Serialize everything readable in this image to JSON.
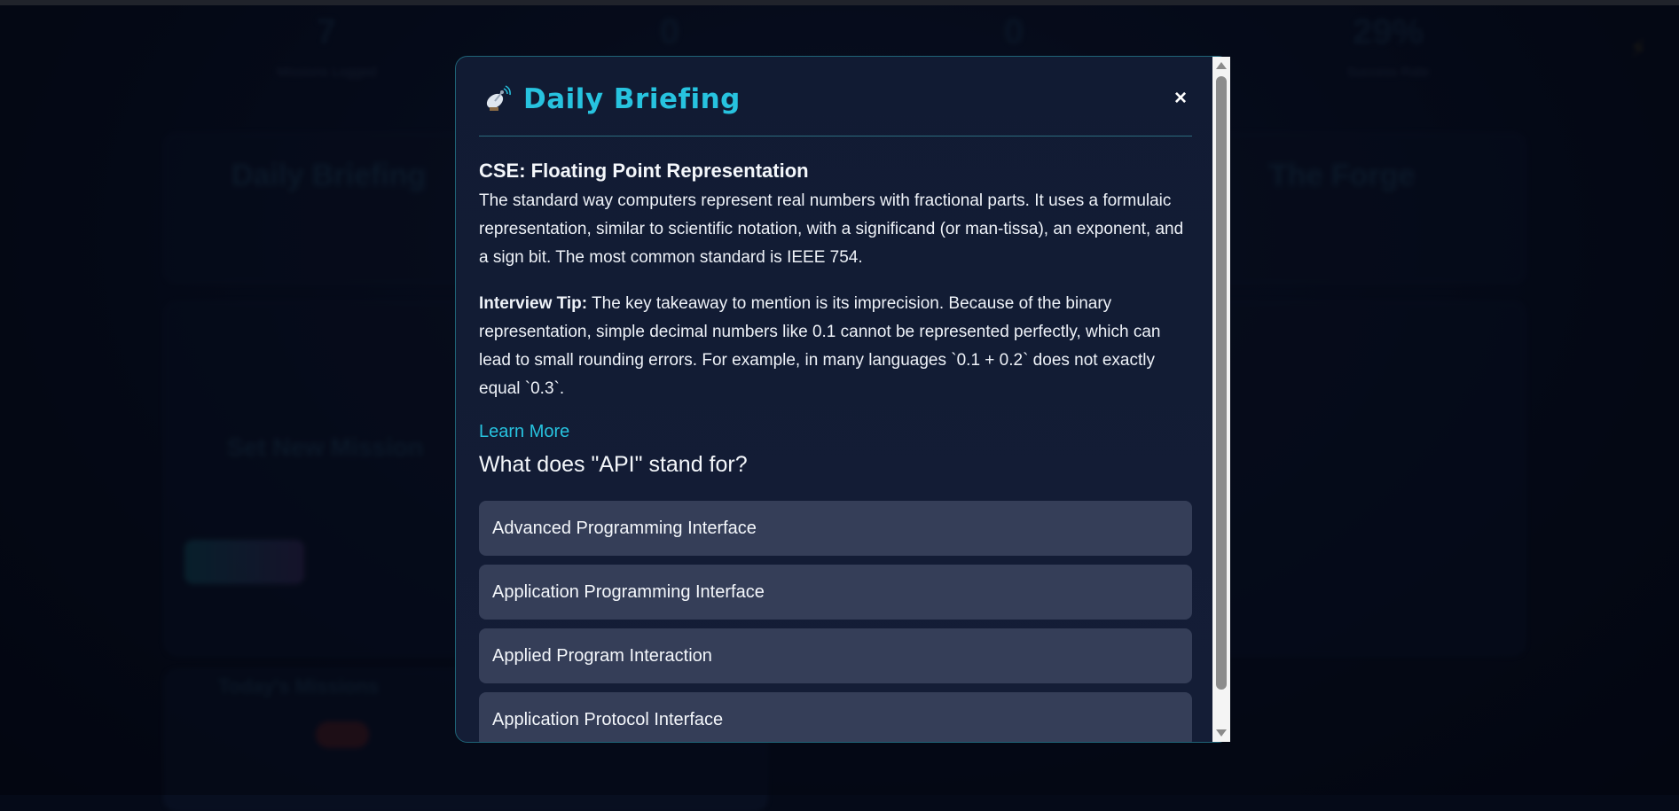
{
  "background": {
    "stats": [
      {
        "value": "7",
        "label": "Missions Logged"
      },
      {
        "value": "0",
        "label": ""
      },
      {
        "value": "0",
        "label": ""
      },
      {
        "value": "29%",
        "label": "Success Rate"
      }
    ],
    "cards": {
      "briefing_title": "Daily Briefing",
      "forge_title": "The Forge",
      "mission_title": "Set New Mission",
      "today_title": "Today's Missions"
    }
  },
  "modal": {
    "title": "Daily Briefing",
    "close_label": "×",
    "topic_title": "CSE: Floating Point Representation",
    "topic_body": "The standard way computers represent real numbers with fractional parts. It uses a formulaic representation, similar to scientific notation, with a significand (or man-tissa), an exponent, and a sign bit. The most common standard is IEEE 754.",
    "tip_label": "Interview Tip:",
    "tip_text": " The key takeaway to mention is its imprecision. Because of the binary representation, simple decimal numbers like 0.1 cannot be represented perfectly, which can lead to small rounding errors. For example, in many languages `0.1 + 0.2` does not exactly equal `0.3`.",
    "learn_more": "Learn More",
    "question": "What does \"API\" stand for?",
    "options": [
      "Advanced Programming Interface",
      "Application Programming Interface",
      "Applied Program Interaction",
      "Application Protocol Interface"
    ]
  },
  "colors": {
    "accent": "#27c3df",
    "modal_bg": "#111b33",
    "option_bg": "#353e58"
  },
  "icons": {
    "header": "satellite-dish-icon",
    "close": "close-icon",
    "background_bolt": "lightning-icon"
  }
}
